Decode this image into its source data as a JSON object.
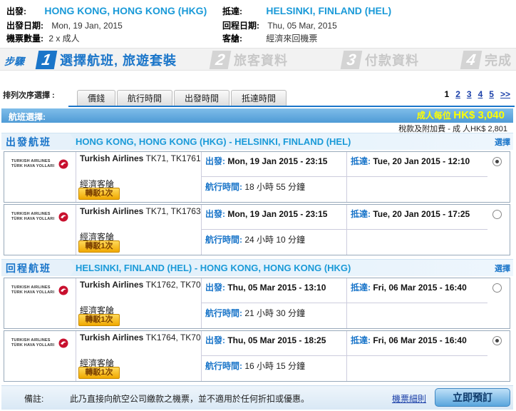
{
  "summary": {
    "from_label": "出發:",
    "from_value": "HONG KONG, HONG KONG (HKG)",
    "to_label": "抵達:",
    "to_value": "HELSINKI, FINLAND (HEL)",
    "depart_date_label": "出發日期:",
    "depart_date_value": "Mon, 19 Jan, 2015",
    "return_date_label": "回程日期:",
    "return_date_value": "Thu, 05 Mar, 2015",
    "tickets_label": "機票數量:",
    "tickets_value": "2 x 成人",
    "cabin_label": "客艙:",
    "cabin_value": "經濟來回機票"
  },
  "steps": {
    "label": "步驟",
    "items": [
      {
        "num": "1",
        "label": "選擇航班, 旅遊套裝"
      },
      {
        "num": "2",
        "label": "旅客資料"
      },
      {
        "num": "3",
        "label": "付款資料"
      },
      {
        "num": "4",
        "label": "完成"
      }
    ]
  },
  "sort": {
    "label": "排列次序選擇 :",
    "tabs": [
      "價錢",
      "航行時間",
      "出發時間",
      "抵達時間"
    ]
  },
  "pager": {
    "current": "1",
    "pages": [
      "2",
      "3",
      "4",
      "5"
    ],
    "next": ">>"
  },
  "flight_header": {
    "label": "航班選擇:",
    "price_label": "成人每位",
    "price_value": "HK$ 3,040",
    "tax": "稅款及附加費 - 成 人HK$ 2,801"
  },
  "sections": [
    {
      "tag": "出發航班",
      "route": "HONG KONG, HONG KONG (HKG) - HELSINKI, FINLAND (HEL)",
      "select_label": "選擇",
      "flights": [
        {
          "airline": "Turkish Airlines",
          "flight_no": "TK71, TK1761",
          "cabin": "經濟客艙",
          "stops": "轉駁1次",
          "dep_label": "出發:",
          "dep": "Mon, 19 Jan 2015 - 23:15",
          "arr_label": "抵達:",
          "arr": "Tue, 20 Jan 2015 - 12:10",
          "dur_label": "航行時間:",
          "dur": "18 小時 55 分鐘",
          "selected": true
        },
        {
          "airline": "Turkish Airlines",
          "flight_no": "TK71, TK1763",
          "cabin": "經濟客艙",
          "stops": "轉駁1次",
          "dep_label": "出發:",
          "dep": "Mon, 19 Jan 2015 - 23:15",
          "arr_label": "抵達:",
          "arr": "Tue, 20 Jan 2015 - 17:25",
          "dur_label": "航行時間:",
          "dur": "24 小時 10 分鐘",
          "selected": false
        }
      ]
    },
    {
      "tag": "回程航班",
      "route": "HELSINKI, FINLAND (HEL) - HONG KONG, HONG KONG (HKG)",
      "select_label": "選擇",
      "flights": [
        {
          "airline": "Turkish Airlines",
          "flight_no": "TK1762, TK70",
          "cabin": "經濟客艙",
          "stops": "轉駁1次",
          "dep_label": "出發:",
          "dep": "Thu, 05 Mar 2015 - 13:10",
          "arr_label": "抵達:",
          "arr": "Fri, 06 Mar 2015 - 16:40",
          "dur_label": "航行時間:",
          "dur": "21 小時 30 分鐘",
          "selected": false
        },
        {
          "airline": "Turkish Airlines",
          "flight_no": "TK1764, TK70",
          "cabin": "經濟客艙",
          "stops": "轉駁1次",
          "dep_label": "出發:",
          "dep": "Thu, 05 Mar 2015 - 18:25",
          "arr_label": "抵達:",
          "arr": "Fri, 06 Mar 2015 - 16:40",
          "dur_label": "航行時間:",
          "dur": "16 小時 15 分鐘",
          "selected": true
        }
      ]
    }
  ],
  "logo": {
    "line1": "TURKISH AIRLINES",
    "line2": "TÜRK HAVA YOLLARI",
    "color": "#c8102e"
  },
  "footer": {
    "remark_label": "備註:",
    "remark": "此乃直接向航空公司繳款之機票，並不適用於任何折扣或優惠。",
    "rules_link": "機票細則",
    "book_button": "立即預訂"
  },
  "colors": {
    "accent": "#1a75c9",
    "route": "#1a9ad8",
    "price": "#ffff00",
    "stop_badge": "#f0a800"
  }
}
